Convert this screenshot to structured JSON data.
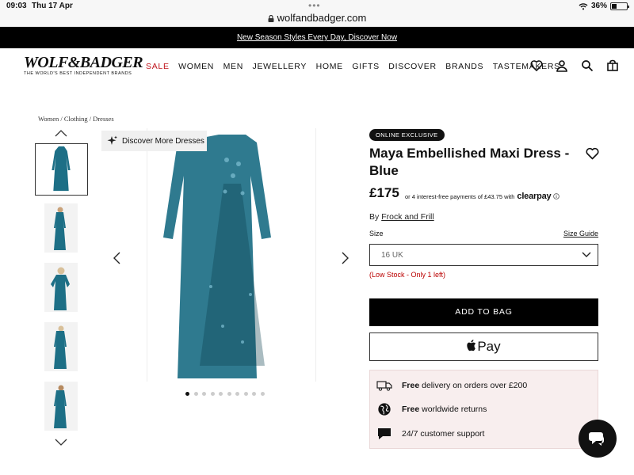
{
  "status_bar": {
    "time": "09:03",
    "date": "Thu 17 Apr",
    "url": "wolfandbadger.com",
    "battery": "36%",
    "battery_level": 0.36
  },
  "promo": {
    "text": "New Season Styles Every Day, Discover Now"
  },
  "header": {
    "logo_mark": "WOLF&BADGER",
    "logo_tagline": "THE WORLD'S BEST INDEPENDENT BRANDS",
    "nav": [
      "SALE",
      "WOMEN",
      "MEN",
      "JEWELLERY",
      "HOME",
      "GIFTS",
      "DISCOVER",
      "BRANDS",
      "TASTEMAKERS"
    ],
    "icons": [
      "heart-icon",
      "account-icon",
      "search-icon",
      "bag-icon"
    ]
  },
  "breadcrumb": "Women / Clothing / Dresses",
  "gallery": {
    "discover_label": "Discover More Dresses",
    "dot_count": 10,
    "active_dot": 0,
    "dress_color": "#1d6f86"
  },
  "product": {
    "badge": "ONLINE EXCLUSIVE",
    "title": "Maya Embellished Maxi Dress - Blue",
    "price": "£175",
    "installments": "or 4 interest-free payments of £43.75 with",
    "installments_brand": "clearpay",
    "by_prefix": "By",
    "brand": "Frock and Frill",
    "size_label": "Size",
    "size_guide": "Size Guide",
    "size_selected": "16 UK",
    "stock_note": "(Low Stock - Only 1 left)",
    "add_to_bag": "ADD TO BAG",
    "apple_pay": "Pay"
  },
  "perks": [
    {
      "bold": "Free",
      "text": " delivery on orders over £200",
      "icon": "truck-icon"
    },
    {
      "bold": "Free",
      "text": " worldwide returns",
      "icon": "globe-icon"
    },
    {
      "bold": "",
      "text": "24/7 customer support",
      "icon": "chat-bubble-icon"
    }
  ]
}
